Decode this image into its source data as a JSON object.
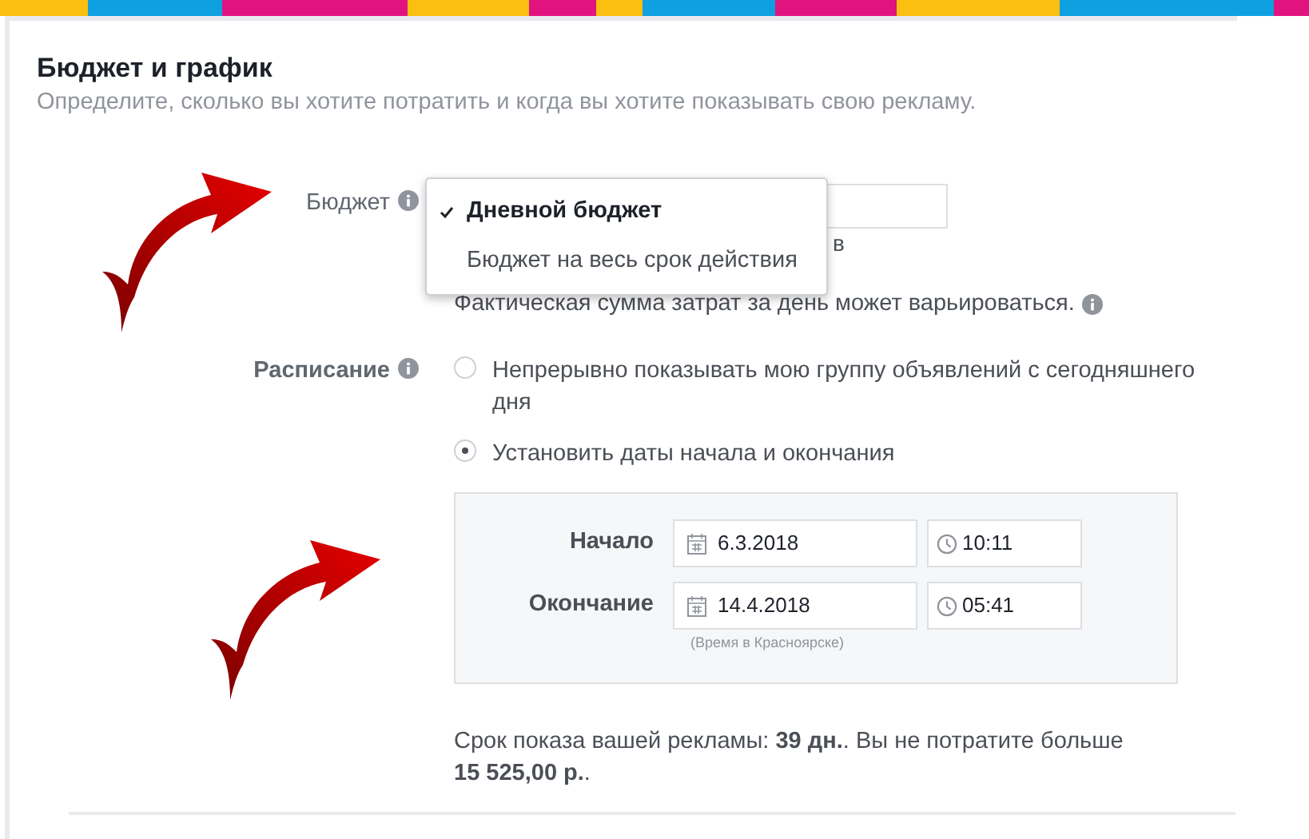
{
  "section": {
    "title": "Бюджет и график",
    "subtitle": "Определите, сколько вы хотите потратить и когда вы хотите показывать свою рекламу."
  },
  "budget": {
    "label": "Бюджет",
    "hidden_text_end": "в",
    "note": "Фактическая сумма затрат за день может варьироваться.",
    "dropdown": [
      {
        "label": "Дневной бюджет",
        "selected": true
      },
      {
        "label": "Бюджет на весь срок действия",
        "selected": false
      }
    ]
  },
  "schedule": {
    "label": "Расписание",
    "options": [
      {
        "label": "Непрерывно показывать мою группу объявлений с сегодняшнего дня",
        "selected": false
      },
      {
        "label": "Установить даты начала и окончания",
        "selected": true
      }
    ],
    "dates": [
      {
        "label": "Начало",
        "date": "6.3.2018",
        "time": "10:11"
      },
      {
        "label": "Окончание",
        "date": "14.4.2018",
        "time": "05:41"
      }
    ],
    "timezone_note": "(Время в Красноярске)"
  },
  "summary": "Срок показа вашей рекламы: **39 дн.**. Вы не потратите больше **15 525,00 р.**."
}
